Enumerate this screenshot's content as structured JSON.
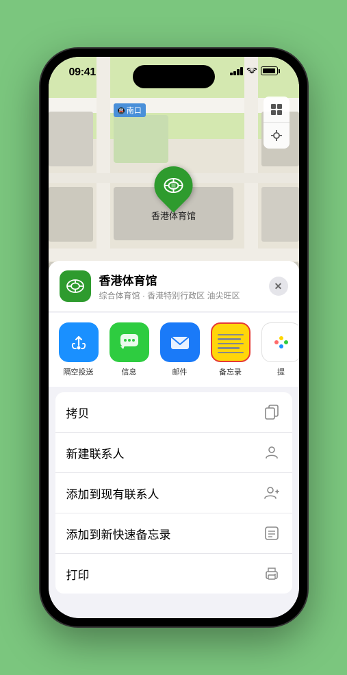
{
  "status_bar": {
    "time": "09:41",
    "location_icon": "▶"
  },
  "map": {
    "station_label": "南口",
    "marker_label": "香港体育馆"
  },
  "place_header": {
    "name": "香港体育馆",
    "subtitle": "综合体育馆 · 香港特别行政区 油尖旺区"
  },
  "share_items": [
    {
      "id": "airdrop",
      "label": "隔空投送"
    },
    {
      "id": "message",
      "label": "信息"
    },
    {
      "id": "mail",
      "label": "邮件"
    },
    {
      "id": "notes",
      "label": "备忘录"
    },
    {
      "id": "more",
      "label": "提"
    }
  ],
  "action_items": [
    {
      "label": "拷贝",
      "icon": "copy"
    },
    {
      "label": "新建联系人",
      "icon": "person"
    },
    {
      "label": "添加到现有联系人",
      "icon": "person-add"
    },
    {
      "label": "添加到新快速备忘录",
      "icon": "note"
    },
    {
      "label": "打印",
      "icon": "print"
    }
  ],
  "close_button_label": "×"
}
